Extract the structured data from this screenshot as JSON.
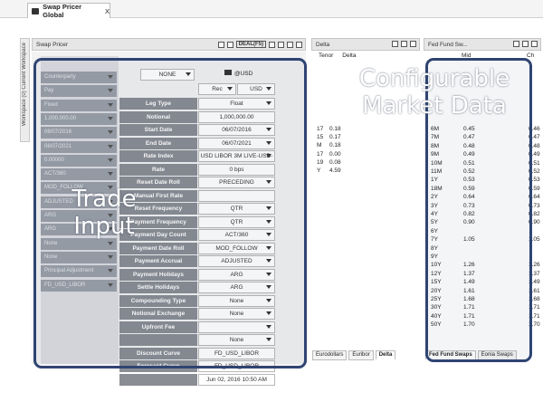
{
  "document_tab": {
    "title": "Swap Pricer Global",
    "close": "X"
  },
  "side_tabs": [
    "Workspace (0) Current Workspace"
  ],
  "pricer": {
    "title": "Swap Pricer",
    "deal_button": "DEAL(F5)",
    "left_top": [
      "Counterparty",
      "Pay",
      "USD",
      "Fixed",
      "1,000,000.00",
      "06/07/2016",
      "06/07/2021",
      "0.00000",
      "Principal Adjustment",
      "FD_USD_LIBOR"
    ],
    "left_cells": [
      "Counterparty",
      "Pay",
      "Fixed",
      "1,000,000.00",
      "06/07/2016",
      "06/07/2021",
      "0.00000",
      "ACT/360",
      "MOD_FOLLOW",
      "ADJUSTED",
      "ARG",
      "ARG",
      "None",
      "None",
      "Principal Adjustment",
      "FD_USD_LIBOR"
    ],
    "ccy_header": "@USD",
    "rec": "Rec",
    "ccy": "USD",
    "none": "NONE",
    "rows": [
      {
        "label": "Leg Type",
        "value": "Float",
        "dd": true
      },
      {
        "label": "Notional",
        "value": "1,000,000.00",
        "dd": false
      },
      {
        "label": "Start Date",
        "value": "06/07/2016",
        "dd": true
      },
      {
        "label": "End Date",
        "value": "06/07/2021",
        "dd": true
      },
      {
        "label": "Rate Index",
        "value": "USD LIBOR 3M LIVE-USD-LIB",
        "dd": true
      },
      {
        "label": "Rate",
        "value": "0 bps",
        "dd": false
      },
      {
        "label": "Reset Date Roll",
        "value": "PRECEDING",
        "dd": true
      },
      {
        "label": "Manual First Rate",
        "value": "",
        "dd": false
      },
      {
        "label": "Reset Frequency",
        "value": "QTR",
        "dd": true
      },
      {
        "label": "Payment Frequency",
        "value": "QTR",
        "dd": true
      },
      {
        "label": "Payment Day Count",
        "value": "ACT/360",
        "dd": true
      },
      {
        "label": "Payment Date Roll",
        "value": "MOD_FOLLOW",
        "dd": true
      },
      {
        "label": "Payment Accrual",
        "value": "ADJUSTED",
        "dd": true
      },
      {
        "label": "Payment Holidays",
        "value": "ARG",
        "dd": true
      },
      {
        "label": "Settle Holidays",
        "value": "ARG",
        "dd": true
      },
      {
        "label": "Compounding Type",
        "value": "None",
        "dd": true
      },
      {
        "label": "Notional Exchange",
        "value": "None",
        "dd": true
      },
      {
        "label": "Upfront Fee",
        "value": "",
        "dd": true
      },
      {
        "label": "",
        "value": "None",
        "dd": true
      },
      {
        "label": "Discount Curve",
        "value": "FD_USD_LIBOR",
        "dd": false
      },
      {
        "label": "Forecast Curve",
        "value": "FD_USD_LIBOR",
        "dd": false
      },
      {
        "label": "",
        "value": "Jun 02, 2016 10:50 AM",
        "dd": false
      }
    ]
  },
  "delta": {
    "title": "Delta",
    "headers": [
      "Tenor",
      "Delta"
    ],
    "rows": [
      [
        "17",
        "0.18"
      ],
      [
        "15",
        "0.17"
      ],
      [
        "M",
        "0.18"
      ],
      [
        "17",
        "0.00"
      ],
      [
        "19",
        "0.08"
      ],
      [
        "Y",
        "4.59"
      ]
    ],
    "tabs": [
      "Eurodollars",
      "Euribor",
      "Delta"
    ],
    "active_tab": "Delta"
  },
  "fedfunds": {
    "title": "Fed Fund Sw...",
    "headers": [
      "",
      "Mid",
      "Ch"
    ],
    "rows": [
      [
        "6M",
        "0.45",
        "0.46"
      ],
      [
        "7M",
        "0.47",
        "0.47"
      ],
      [
        "8M",
        "0.48",
        "0.48"
      ],
      [
        "9M",
        "0.49",
        "0.49"
      ],
      [
        "10M",
        "0.51",
        "0.51"
      ],
      [
        "11M",
        "0.52",
        "0.52"
      ],
      [
        "1Y",
        "0.53",
        "0.53"
      ],
      [
        "18M",
        "0.59",
        "0.59"
      ],
      [
        "2Y",
        "0.64",
        "0.64"
      ],
      [
        "3Y",
        "0.73",
        "0.73"
      ],
      [
        "4Y",
        "0.82",
        "0.82"
      ],
      [
        "5Y",
        "0.90",
        "0.90"
      ],
      [
        "6Y",
        "",
        ""
      ],
      [
        "7Y",
        "1.05",
        "1.05"
      ],
      [
        "8Y",
        "",
        ""
      ],
      [
        "9Y",
        "",
        ""
      ],
      [
        "10Y",
        "1.26",
        "1.26"
      ],
      [
        "12Y",
        "1.37",
        "1.37"
      ],
      [
        "15Y",
        "1.49",
        "1.49"
      ],
      [
        "20Y",
        "1.61",
        "1.61"
      ],
      [
        "25Y",
        "1.68",
        "1.68"
      ],
      [
        "30Y",
        "1.71",
        "1.71"
      ],
      [
        "40Y",
        "1.71",
        "1.71"
      ],
      [
        "50Y",
        "1.70",
        "1.70"
      ]
    ],
    "tabs": [
      "Fed Fund Swaps",
      "Eonia Swaps"
    ],
    "active_tab": "Fed Fund Swaps"
  },
  "overlays": {
    "trade_input": [
      "Trade",
      "Input"
    ],
    "market_data": [
      "Configurable",
      "Market Data"
    ]
  },
  "colors": {
    "overlay_border": "#2f4472",
    "label_bg": "#8a8d93"
  }
}
